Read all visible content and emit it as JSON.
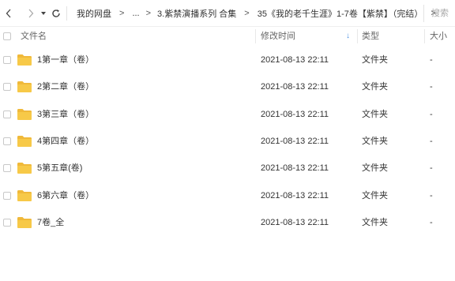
{
  "toolbar": {
    "back_glyph": "<",
    "forward_glyph": ">",
    "history_dropdown_glyph": "▾",
    "refresh_glyph": "C",
    "breadcrumbs": [
      "我的网盘",
      "...",
      "3.紫禁演播系列 合集",
      "35《我的老千生涯》1-7卷【紫禁】（完结）"
    ],
    "crumb_separator": ">",
    "search_placeholder": "搜索"
  },
  "table": {
    "headers": {
      "name": "文件名",
      "modified": "修改时间",
      "type": "类型",
      "size": "大小"
    },
    "sort_indicator": "↓",
    "rows": [
      {
        "name": "1第一章（卷）",
        "modified": "2021-08-13 22:11",
        "type": "文件夹",
        "size": "-"
      },
      {
        "name": "2第二章（卷）",
        "modified": "2021-08-13 22:11",
        "type": "文件夹",
        "size": "-"
      },
      {
        "name": "3第三章（卷）",
        "modified": "2021-08-13 22:11",
        "type": "文件夹",
        "size": "-"
      },
      {
        "name": "4第四章（卷）",
        "modified": "2021-08-13 22:11",
        "type": "文件夹",
        "size": "-"
      },
      {
        "name": "5第五章(卷)",
        "modified": "2021-08-13 22:11",
        "type": "文件夹",
        "size": "-"
      },
      {
        "name": "6第六章（卷）",
        "modified": "2021-08-13 22:11",
        "type": "文件夹",
        "size": "-"
      },
      {
        "name": "7卷_全",
        "modified": "2021-08-13 22:11",
        "type": "文件夹",
        "size": "-"
      }
    ]
  },
  "colors": {
    "folder": "#f7c948",
    "folder_tab": "#f0b93a",
    "sort_arrow": "#4a90e2"
  },
  "icons": {
    "folder": "folder-icon",
    "refresh": "refresh-icon",
    "back": "back-arrow-icon",
    "forward": "forward-arrow-icon"
  }
}
